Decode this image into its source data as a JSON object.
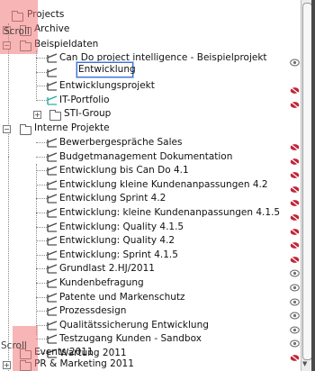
{
  "tree": {
    "root_label": "Projects",
    "archive_label": "Archive",
    "beispieldaten_label": "Beispieldaten",
    "beispieldaten_items": [
      {
        "label": "Can Do project intelligence - Beispielprojekt",
        "status": "eye"
      },
      {
        "label": "Entwicklung",
        "status": "none",
        "editing": true
      },
      {
        "label": "Entwicklungsprojekt",
        "status": "hidden"
      },
      {
        "label": "IT-Portfolio",
        "status": "hidden"
      }
    ],
    "sti_group_label": "STI-Group",
    "interne_label": "Interne Projekte",
    "interne_items": [
      {
        "label": "Bewerbergespräche Sales",
        "status": "hidden"
      },
      {
        "label": "Budgetmanagement Dokumentation",
        "status": "hidden"
      },
      {
        "label": "Entwicklung bis Can Do 4.1",
        "status": "hidden"
      },
      {
        "label": "Entwicklung kleine Kundenanpassungen 4.2",
        "status": "hidden"
      },
      {
        "label": "Entwicklung Sprint 4.2",
        "status": "hidden"
      },
      {
        "label": "Entwicklung: kleine Kundenanpassungen 4.1.5",
        "status": "hidden"
      },
      {
        "label": "Entwicklung: Quality 4.1.5",
        "status": "hidden"
      },
      {
        "label": "Entwicklung: Quality 4.2",
        "status": "hidden"
      },
      {
        "label": "Entwicklung: Sprint 4.1.5",
        "status": "hidden"
      },
      {
        "label": "Grundlast 2.HJ/2011",
        "status": "eye"
      },
      {
        "label": "Kundenbefragung",
        "status": "eye"
      },
      {
        "label": "Patente und Markenschutz",
        "status": "eye"
      },
      {
        "label": "Prozessdesign",
        "status": "eye"
      },
      {
        "label": "Qualitätssicherung Entwicklung",
        "status": "eye"
      },
      {
        "label": "Testzugang Kunden - Sandbox",
        "status": "eye"
      },
      {
        "label": "Wartung 2011",
        "status": "hidden"
      }
    ],
    "events_label": "Events 2011",
    "pr_label": "PR & Marketing 2011"
  },
  "overlays": {
    "top_label": "Scroll",
    "bottom_label": "Scroll"
  },
  "colors": {
    "hidden_icon": "#c0253a",
    "eye_icon": "#707070",
    "project_icon": "#4a4a4a",
    "project_selected": "#2ba8a0"
  }
}
